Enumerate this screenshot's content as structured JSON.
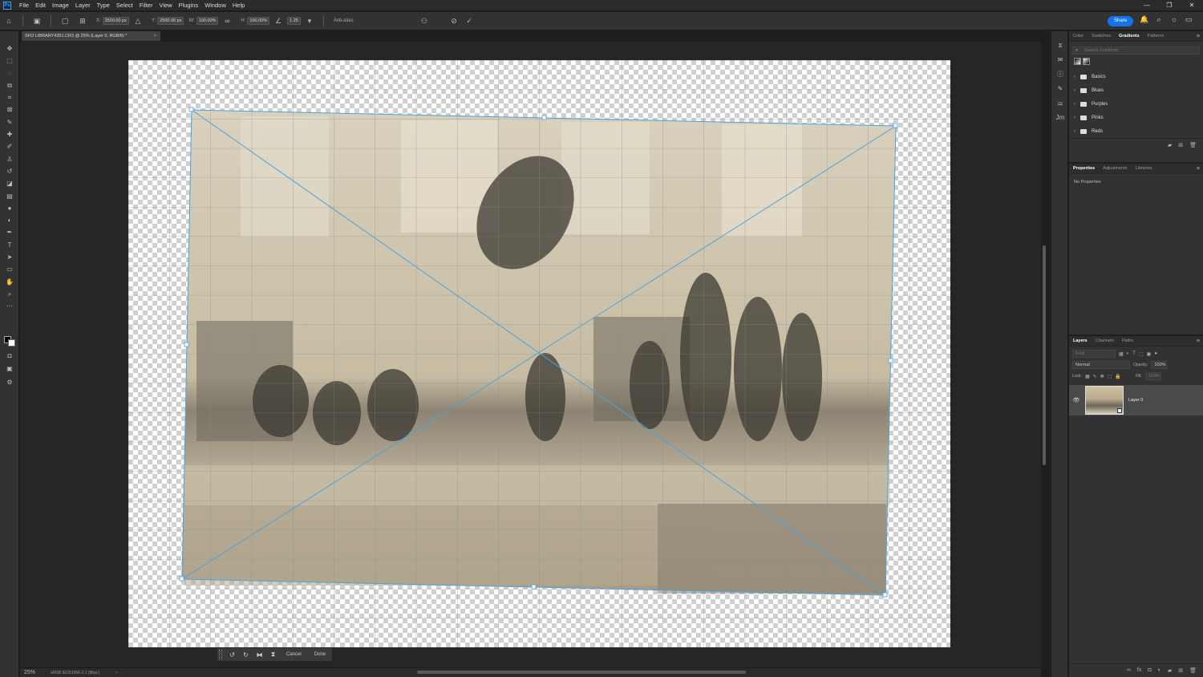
{
  "app": {
    "logo": "Ps",
    "menus": [
      "File",
      "Edit",
      "Image",
      "Layer",
      "Type",
      "Select",
      "Filter",
      "View",
      "Plugins",
      "Window",
      "Help"
    ]
  },
  "options": {
    "x_label": "X:",
    "x_value": "3500.00 px",
    "y_label": "Y:",
    "y_value": "2500.00 px",
    "w_label": "W:",
    "w_value": "100.00%",
    "h_label": "H:",
    "h_value": "100.00%",
    "angle_value": "1.25",
    "antialias": "Anti-alias",
    "share": "Share"
  },
  "document": {
    "tab_title": "SFO LIBRARY4351.CR3 @ 25% (Layer 0, RGB/8) *",
    "zoom": "25%",
    "status_info": "sRGB IEC61966-2.1 (8bpc)"
  },
  "transform_bar": {
    "cancel": "Cancel",
    "done": "Done"
  },
  "panels": {
    "color_tabs": [
      "Color",
      "Swatches",
      "Gradients",
      "Patterns"
    ],
    "gradient_search_placeholder": "Search Gradients",
    "gradient_folders": [
      "Basics",
      "Blues",
      "Purples",
      "Pinks",
      "Reds"
    ],
    "props_tabs": [
      "Properties",
      "Adjustments",
      "Libraries"
    ],
    "no_properties": "No Properties",
    "layers_tabs": [
      "Layers",
      "Channels",
      "Paths"
    ],
    "kind_placeholder": "Kind",
    "blend_mode": "Normal",
    "opacity_label": "Opacity:",
    "opacity_value": "100%",
    "lock_label": "Lock:",
    "fill_label": "Fill:",
    "fill_value": "100%",
    "layer_name": "Layer 0"
  },
  "colors": {
    "accent": "#1473e6",
    "transform_line": "#4aa3df"
  }
}
